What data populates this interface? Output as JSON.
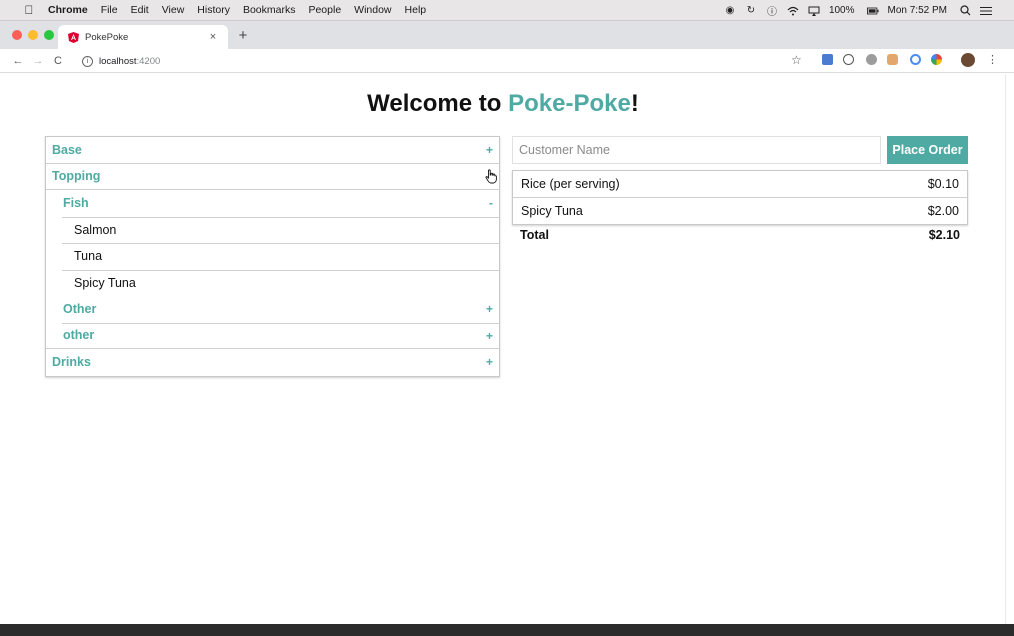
{
  "menubar": {
    "apple_icon": "apple-logo-icon",
    "app_name": "Chrome",
    "items": [
      "File",
      "Edit",
      "View",
      "History",
      "Bookmarks",
      "People",
      "Window",
      "Help"
    ],
    "battery": "100%",
    "clock": "Mon 7:52 PM"
  },
  "browser": {
    "tab_title": "PokePoke",
    "tab_close": "×",
    "new_tab": "+",
    "back": "←",
    "forward": "→",
    "reload": "C",
    "url_host": "localhost",
    "url_port": ":4200",
    "star": "☆",
    "menu": "⋮"
  },
  "page": {
    "heading_prefix": "Welcome to ",
    "brand": "Poke-Poke",
    "heading_suffix": "!"
  },
  "menu": {
    "base": {
      "label": "Base",
      "toggle": "+"
    },
    "topping": {
      "label": "Topping"
    },
    "fish": {
      "label": "Fish",
      "toggle": "-"
    },
    "fish_items": [
      "Salmon",
      "Tuna",
      "Spicy Tuna"
    ],
    "other": {
      "label": "Other",
      "toggle": "+"
    },
    "other_lower": {
      "label": "other",
      "toggle": "+"
    },
    "drinks": {
      "label": "Drinks",
      "toggle": "+"
    }
  },
  "order": {
    "placeholder": "Customer Name",
    "button": "Place Order",
    "items": [
      {
        "name": "Rice (per serving)",
        "price": "$0.10"
      },
      {
        "name": "Spicy Tuna",
        "price": "$2.00"
      }
    ],
    "total_label": "Total",
    "total_value": "$2.10"
  },
  "colors": {
    "accent": "#4eaaa2"
  }
}
